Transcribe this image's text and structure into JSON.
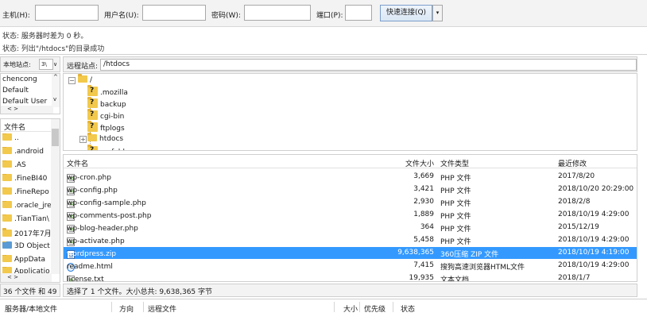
{
  "quickconnect": {
    "host_label": "主机(H):",
    "user_label": "用户名(U):",
    "pass_label": "密码(W):",
    "port_label": "端口(P):",
    "connect_button": "快速连接(Q)",
    "dropdown_glyph": "▾"
  },
  "log": {
    "line1": "状态:  服务器时差为 0 秒。",
    "line2": "状态:  列出\"/htdocs\"的目录成功"
  },
  "local": {
    "site_label": "本地站点:",
    "site_path": "3\\",
    "site_arrow": "∨",
    "tree": [
      "chencong",
      "Default",
      "Default User"
    ],
    "scroll_up": "^",
    "scroll_down": "v",
    "hscroll": "<   >",
    "column_header": "文件名",
    "files": [
      "..",
      ".android",
      ".AS",
      ".FineBI40",
      ".FineRepo",
      ".oracle_jre",
      ".TianTian\\",
      "2017年7月",
      "3D Object",
      "AppData",
      "Applicatio"
    ],
    "status": "36 个文件 和 49"
  },
  "remote": {
    "site_label": "远程站点:",
    "site_path": "/htdocs",
    "tree": {
      "root": "/",
      "items": [
        ".mozilla",
        "backup",
        "cgi-bin",
        "ftplogs",
        "htdocs",
        "myfolder"
      ]
    },
    "columns": {
      "name": "文件名",
      "size": "文件大小",
      "type": "文件类型",
      "modified": "最近修改"
    },
    "files": [
      {
        "name": "wp-cron.php",
        "size": "3,669",
        "type": "PHP 文件",
        "modified": "2017/8/20"
      },
      {
        "name": "wp-config.php",
        "size": "3,421",
        "type": "PHP 文件",
        "modified": "2018/10/20 20:29:00"
      },
      {
        "name": "wp-config-sample.php",
        "size": "2,930",
        "type": "PHP 文件",
        "modified": "2018/2/8"
      },
      {
        "name": "wp-comments-post.php",
        "size": "1,889",
        "type": "PHP 文件",
        "modified": "2018/10/19 4:29:00"
      },
      {
        "name": "wp-blog-header.php",
        "size": "364",
        "type": "PHP 文件",
        "modified": "2015/12/19"
      },
      {
        "name": "wp-activate.php",
        "size": "5,458",
        "type": "PHP 文件",
        "modified": "2018/10/19 4:29:00"
      },
      {
        "name": "wordpress.zip",
        "size": "9,638,365",
        "type": "360压缩 ZIP 文件",
        "modified": "2018/10/19 4:19:00"
      },
      {
        "name": "readme.html",
        "size": "7,415",
        "type": "搜狗高速浏览器HTML文件",
        "modified": "2018/10/19 4:29:00"
      },
      {
        "name": "license.txt",
        "size": "19,935",
        "type": "文本文档",
        "modified": "2018/1/7"
      }
    ],
    "status": "选择了 1 个文件。大小总共: 9,638,365 字节"
  },
  "queue": {
    "col_server": "服务器/本地文件",
    "col_direction": "方向",
    "col_remote": "远程文件",
    "col_size": "大小",
    "col_priority": "优先级",
    "col_status": "状态"
  }
}
